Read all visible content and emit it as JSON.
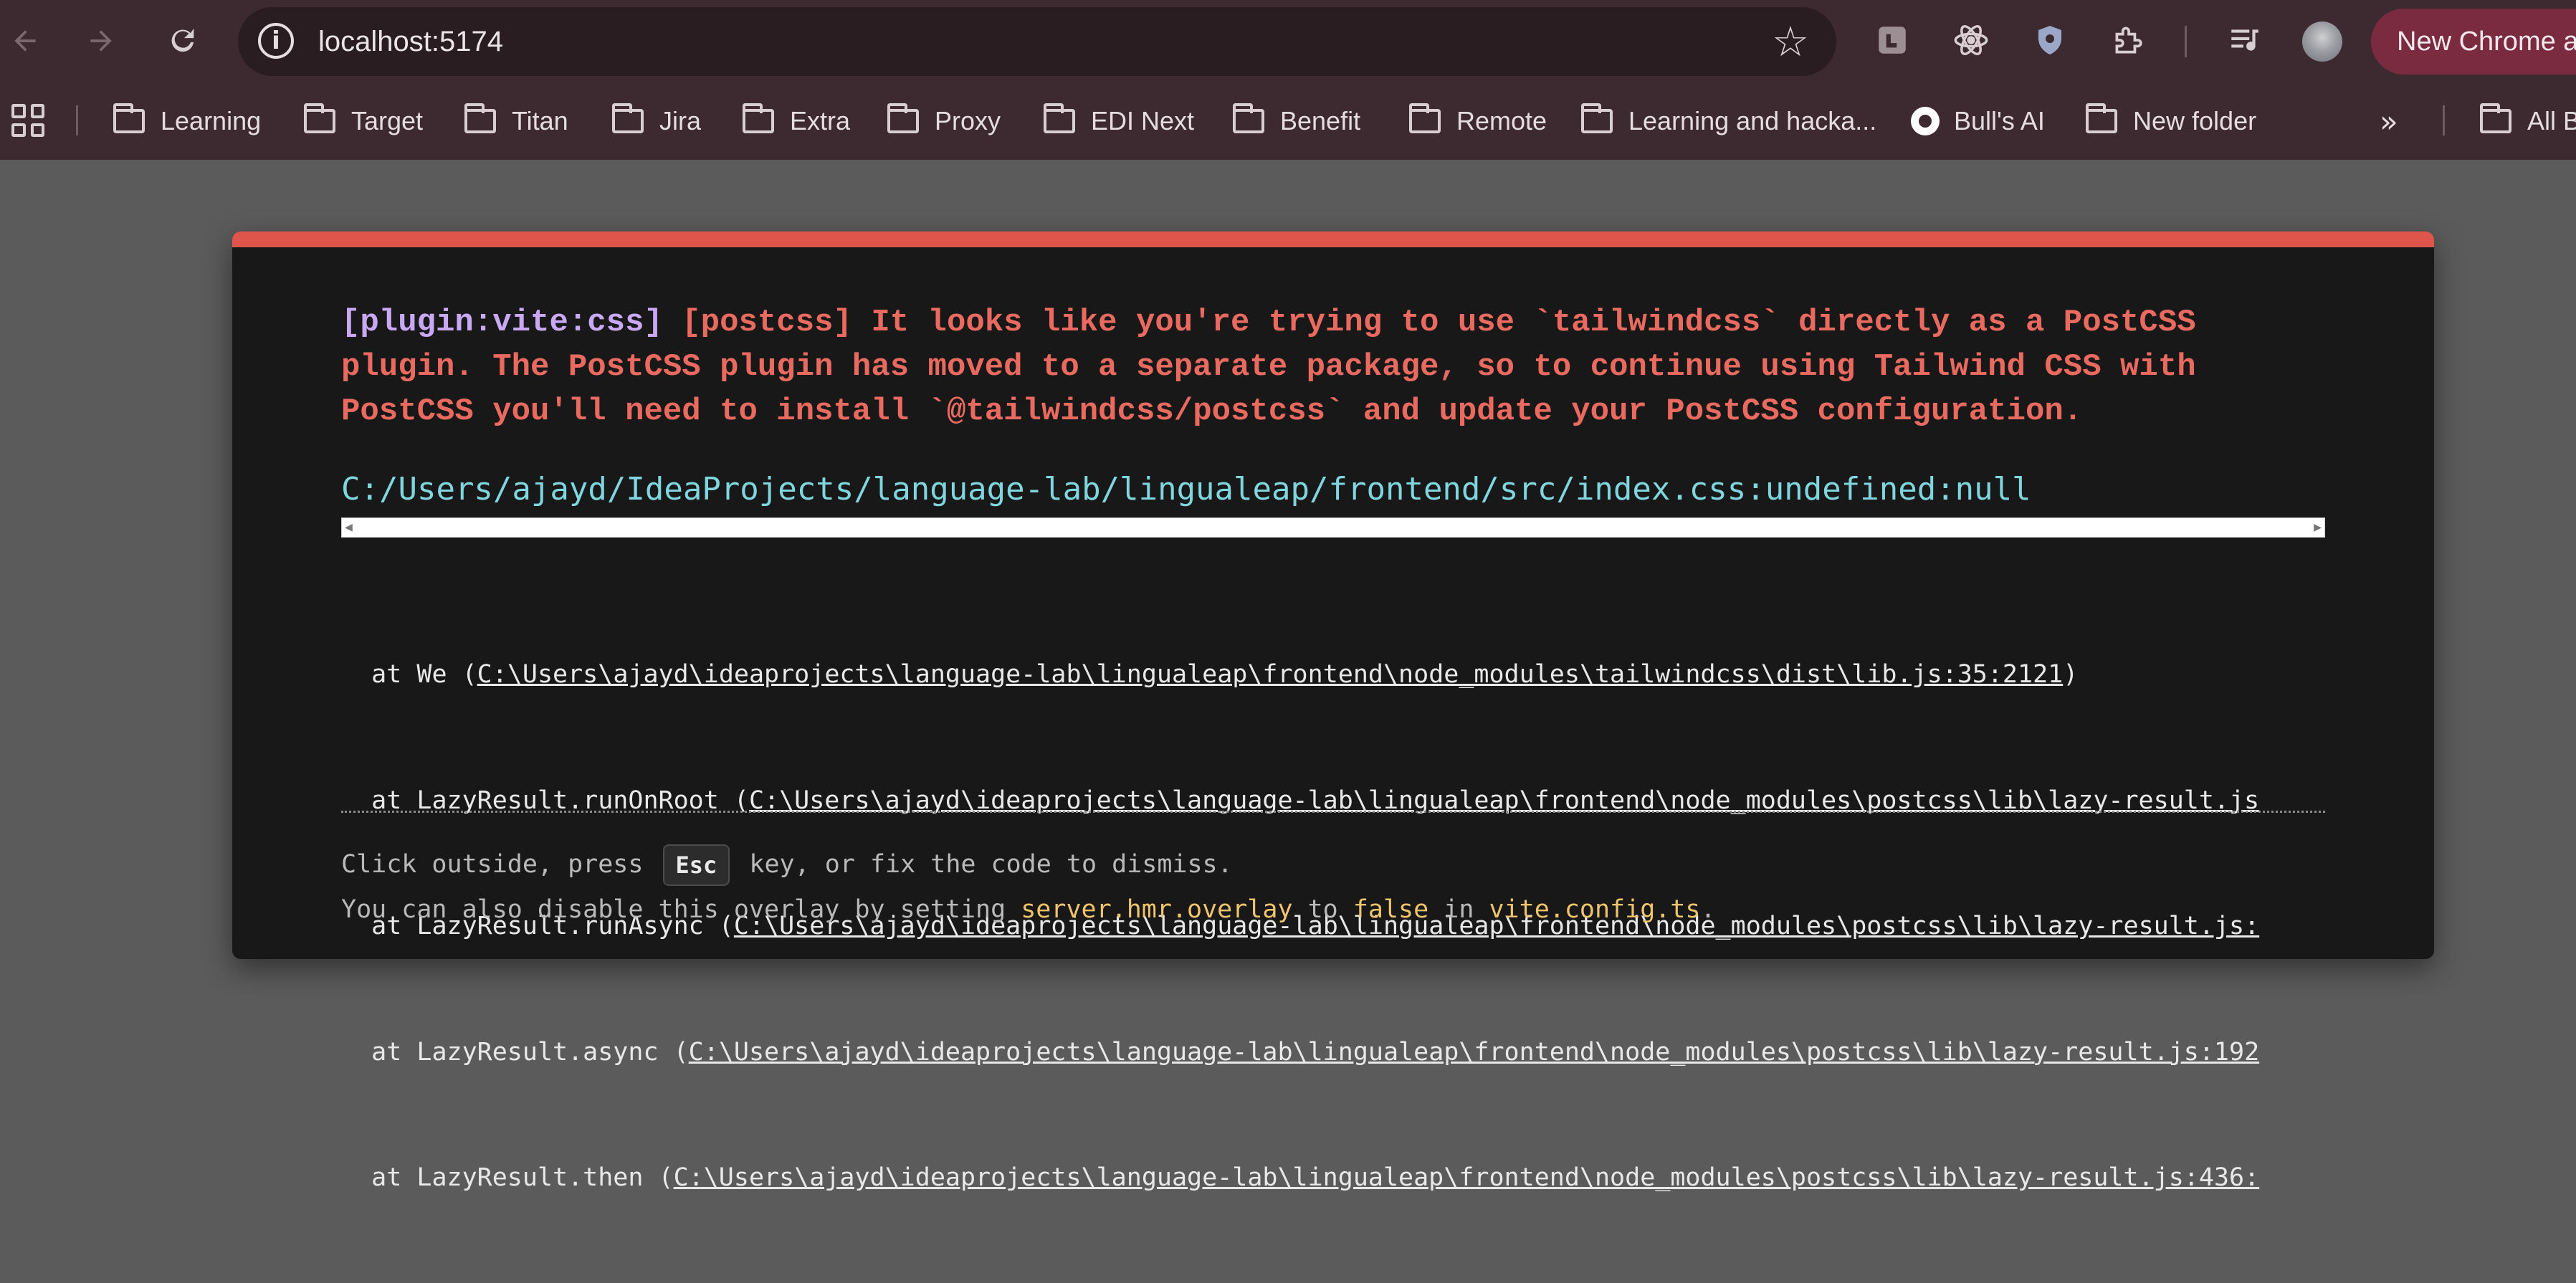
{
  "browser": {
    "url": "localhost:5174",
    "new_chrome_label": "New Chrome av",
    "icons": {
      "back": "back-arrow-icon",
      "forward": "forward-arrow-icon",
      "reload": "reload-icon",
      "site_info": "info-icon",
      "bookmark_star": "star-icon"
    }
  },
  "bookmarks": [
    {
      "label": "Learning",
      "icon": "folder"
    },
    {
      "label": "Target",
      "icon": "folder"
    },
    {
      "label": "Titan",
      "icon": "folder"
    },
    {
      "label": "Jira",
      "icon": "folder"
    },
    {
      "label": "Extra",
      "icon": "folder"
    },
    {
      "label": "Proxy",
      "icon": "folder"
    },
    {
      "label": "EDI Next",
      "icon": "folder"
    },
    {
      "label": "Benefit",
      "icon": "folder"
    },
    {
      "label": "Remote",
      "icon": "folder"
    },
    {
      "label": "Learning and hacka...",
      "icon": "folder"
    },
    {
      "label": "Bull's AI",
      "icon": "site"
    },
    {
      "label": "New folder",
      "icon": "folder"
    },
    {
      "label": "All B",
      "icon": "folder"
    }
  ],
  "overlay": {
    "plugin": "[plugin:vite:css]",
    "message": " [postcss] It looks like you're trying to use `tailwindcss` directly as a PostCSS\nplugin. The PostCSS plugin has moved to a separate package, so to continue using Tailwind CSS with\nPostCSS you'll need to install `@tailwindcss/postcss` and update your PostCSS configuration.",
    "file": "C:/Users/ajayd/IdeaProjects/language-lab/lingualeap/frontend/src/index.css:undefined:null",
    "stack": [
      {
        "prefix": "at We (",
        "link": "C:\\Users\\ajayd\\ideaprojects\\language-lab\\lingualeap\\frontend\\node_modules\\tailwindcss\\dist\\lib.js:35:2121",
        "suffix": ")"
      },
      {
        "prefix": "at LazyResult.runOnRoot (",
        "link": "C:\\Users\\ajayd\\ideaprojects\\language-lab\\lingualeap\\frontend\\node_modules\\postcss\\lib\\lazy-result.js",
        "suffix": ""
      },
      {
        "prefix": "at LazyResult.runAsync (",
        "link": "C:\\Users\\ajayd\\ideaprojects\\language-lab\\lingualeap\\frontend\\node_modules\\postcss\\lib\\lazy-result.js:",
        "suffix": ""
      },
      {
        "prefix": "at LazyResult.async (",
        "link": "C:\\Users\\ajayd\\ideaprojects\\language-lab\\lingualeap\\frontend\\node_modules\\postcss\\lib\\lazy-result.js:192",
        "suffix": ""
      },
      {
        "prefix": "at LazyResult.then (",
        "link": "C:\\Users\\ajayd\\ideaprojects\\language-lab\\lingualeap\\frontend\\node_modules\\postcss\\lib\\lazy-result.js:436:",
        "suffix": ""
      }
    ],
    "tip1": {
      "before": "Click outside, press ",
      "key": "Esc",
      "after": " key, or fix the code to dismiss."
    },
    "tip2": {
      "before": "You can also disable this overlay by setting ",
      "setting": "server.hmr.overlay",
      "mid": " to ",
      "value": "false",
      "mid2": " in ",
      "config": "vite.config.ts",
      "end": "."
    },
    "colors": {
      "accent": "#e0554b",
      "message": "#ea6a60",
      "plugin": "#c9a8f5",
      "file": "#7fd6de",
      "code": "#f0c46a"
    }
  }
}
